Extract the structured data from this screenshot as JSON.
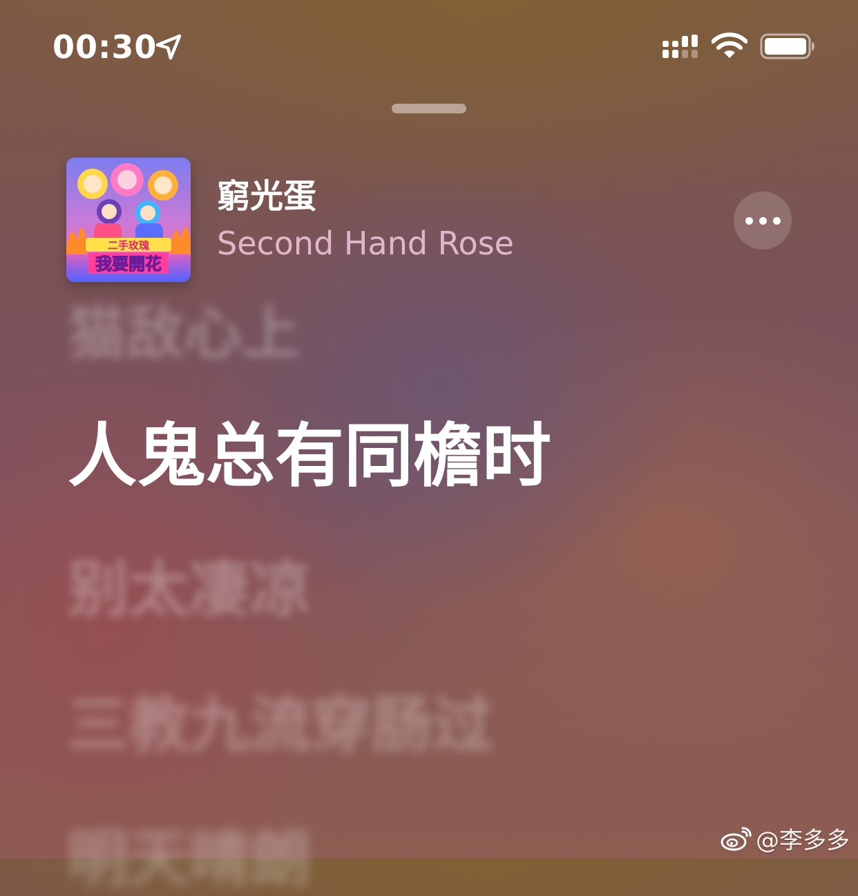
{
  "status_bar": {
    "time": "00:30",
    "icons": [
      "location-arrow-icon",
      "cellular-signal-icon",
      "wifi-icon",
      "battery-icon"
    ]
  },
  "now_playing": {
    "artist": "窮光蛋",
    "title": "Second Hand Rose",
    "album_art": {
      "text_lines": [
        "二手玫瑰",
        "我要開花"
      ]
    },
    "more_icon": "ellipsis-icon"
  },
  "lyrics": {
    "previous": "猫敌心上",
    "current": "人鬼总有同檐时",
    "next": [
      "别太凄凉",
      "三教九流穿肠过",
      "明天晴朗"
    ]
  },
  "watermark": {
    "icon": "weibo-icon",
    "text": "@李多多"
  },
  "colors": {
    "lyric_active": "#ffffff",
    "song_title": "#f4c8de"
  }
}
